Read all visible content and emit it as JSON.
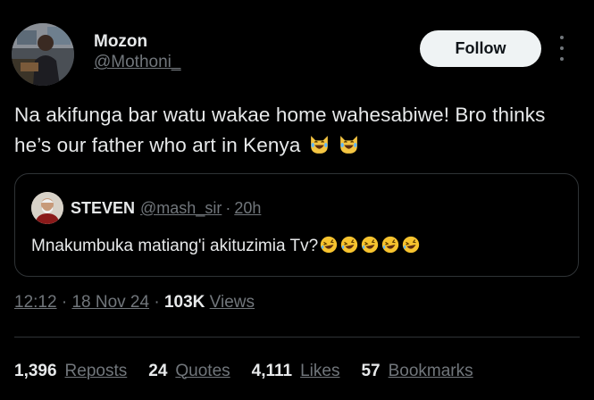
{
  "author": {
    "display_name": "Mozon",
    "handle": "@Mothoni_"
  },
  "follow_label": "Follow",
  "tweet": {
    "text": "Na akifunga bar watu wakae home wahesabiwe! Bro thinks he’s our father who art in Kenya",
    "emojis": [
      "laughing-cat-emoji",
      "laughing-cat-emoji"
    ]
  },
  "quoted_tweet": {
    "author_name": "STEVEN",
    "author_handle": "@mash_sir",
    "separator": "·",
    "time": "20h",
    "text": "Mnakumbuka matiang'i akituzimia Tv?",
    "emojis": [
      "rolling-laughing-emoji",
      "rolling-laughing-emoji",
      "rolling-laughing-emoji",
      "rolling-laughing-emoji",
      "rolling-laughing-emoji"
    ]
  },
  "meta": {
    "time": "12:12",
    "sep1": "·",
    "date": "18 Nov 24",
    "sep2": "·",
    "views_count": "103K",
    "views_label": "Views"
  },
  "stats": [
    {
      "count": "1,396",
      "label": "Reposts"
    },
    {
      "count": "24",
      "label": "Quotes"
    },
    {
      "count": "4,111",
      "label": "Likes"
    },
    {
      "count": "57",
      "label": "Bookmarks"
    }
  ],
  "colors": {
    "background": "#000000",
    "text_primary": "#e7e9ea",
    "text_secondary": "#71767b",
    "border": "#2f3336",
    "follow_bg": "#eff3f4"
  }
}
